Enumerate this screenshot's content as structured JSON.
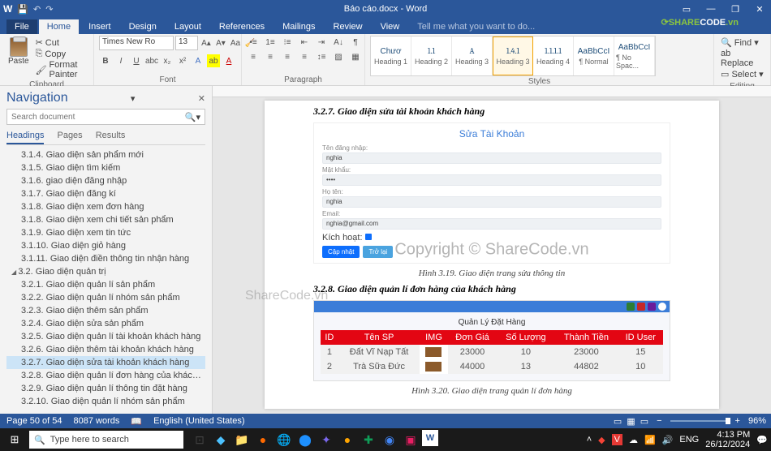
{
  "window": {
    "title": "Báo cáo.docx - Word"
  },
  "tabs": {
    "file": "File",
    "home": "Home",
    "insert": "Insert",
    "design": "Design",
    "layout": "Layout",
    "references": "References",
    "mailings": "Mailings",
    "review": "Review",
    "view": "View",
    "tellme": "Tell me what you want to do..."
  },
  "ribbon": {
    "clipboard": {
      "label": "Clipboard",
      "paste": "Paste",
      "cut": "Cut",
      "copy": "Copy",
      "format_painter": "Format Painter"
    },
    "font": {
      "label": "Font",
      "name": "Times New Ro",
      "size": "13"
    },
    "paragraph": {
      "label": "Paragraph"
    },
    "styles": {
      "label": "Styles",
      "items": [
        {
          "prev": "Chươ",
          "label": "Heading 1"
        },
        {
          "prev": "1.1",
          "label": "Heading 2"
        },
        {
          "prev": "A",
          "label": "Heading 3"
        },
        {
          "prev": "1.4.1",
          "label": "Heading 3"
        },
        {
          "prev": "1.1.1.1",
          "label": "Heading 4"
        },
        {
          "prev": "AaBbCcI",
          "label": "¶ Normal"
        },
        {
          "prev": "AaBbCcI",
          "label": "¶ No Spac..."
        }
      ]
    },
    "editing": {
      "label": "Editing",
      "find": "Find",
      "replace": "Replace",
      "select": "Select"
    }
  },
  "nav": {
    "title": "Navigation",
    "search_ph": "Search document",
    "tabs": {
      "headings": "Headings",
      "pages": "Pages",
      "results": "Results"
    },
    "items": [
      {
        "t": "3.1.4. Giao diện sản phẩm mới",
        "cls": ""
      },
      {
        "t": "3.1.5. Giao diện tìm kiếm",
        "cls": ""
      },
      {
        "t": "3.1.6. giao diện đăng nhập",
        "cls": ""
      },
      {
        "t": "3.1.7. Giao diện đăng kí",
        "cls": ""
      },
      {
        "t": "3.1.8. Giao diện xem đơn hàng",
        "cls": ""
      },
      {
        "t": "3.1.8. Giao diện xem chi tiết sản phẩm",
        "cls": ""
      },
      {
        "t": "3.1.9. Giao diện xem tin tức",
        "cls": ""
      },
      {
        "t": "3.1.10. Giao diện giỏ hàng",
        "cls": ""
      },
      {
        "t": "3.1.11. Giao diện điền thông tin nhận hàng",
        "cls": ""
      },
      {
        "t": "3.2. Giao diện quản trị",
        "cls": "level1"
      },
      {
        "t": "3.2.1. Giao diện quản lí sản phẩm",
        "cls": ""
      },
      {
        "t": "3.2.2. Giao diện quản lí nhóm sản phẩm",
        "cls": ""
      },
      {
        "t": "3.2.3. Giao diện thêm sản phẩm",
        "cls": ""
      },
      {
        "t": "3.2.4. Giao diện sửa sản phẩm",
        "cls": ""
      },
      {
        "t": "3.2.5. Giao diện quản lí tài khoản khách hàng",
        "cls": ""
      },
      {
        "t": "3.2.6. Giao diện thêm tài khoản khách hàng",
        "cls": ""
      },
      {
        "t": "3.2.7. Giao diện sửa tài khoản khách hàng",
        "cls": "selected"
      },
      {
        "t": "3.2.8. Giao diện quản lí đơn hàng của khách hàng",
        "cls": ""
      },
      {
        "t": "3.2.9. Giao diện quản lí thông tin đặt hàng",
        "cls": ""
      },
      {
        "t": "3.2.10. Giao diện quản lí nhóm sản phẩm",
        "cls": ""
      }
    ]
  },
  "doc": {
    "h1": "3.2.7. Giao diện sửa tài khoản khách hàng",
    "form": {
      "title": "Sửa Tài Khoản",
      "user_label": "Tên đăng nhập:",
      "user_val": "nghia",
      "pass_label": "Mật khẩu:",
      "pass_val": "••••",
      "name_label": "Họ tên:",
      "name_val": "nghia",
      "email_label": "Email:",
      "email_val": "nghia@gmail.com",
      "activate": "Kích hoạt:",
      "btn1": "Cập nhật",
      "btn2": "Trở lại"
    },
    "cap1": "Hình 3.19. Giao diện trang sửa thông tin",
    "h2": "3.2.8. Giao diện quản lí đơn hàng của khách hàng",
    "table": {
      "title": "Quản Lý Đặt Hàng",
      "headers": [
        "ID",
        "Tên SP",
        "IMG",
        "Đơn Giá",
        "Số Lượng",
        "Thành Tiền",
        "ID User"
      ],
      "rows": [
        [
          "1",
          "Đất Vĩ Nạp Tất",
          "",
          "23000",
          "10",
          "23000",
          "15"
        ],
        [
          "2",
          "Trà Sữa Đức",
          "",
          "44000",
          "13",
          "44802",
          "10"
        ]
      ]
    },
    "cap2": "Hình 3.20. Giao diện trang quản lí đơn hàng"
  },
  "status": {
    "page": "Page 50 of 54",
    "words": "8087 words",
    "lang": "English (United States)",
    "zoom": "96%"
  },
  "taskbar": {
    "search_ph": "Type here to search",
    "time": "4:13 PM",
    "date": "26/12/2024",
    "lang": "ENG"
  },
  "watermark": "Copyright © ShareCode.vn",
  "logo": {
    "a": "SHARE",
    "b": "CODE",
    "c": ".vn"
  },
  "wm2": "ShareCode.vn"
}
